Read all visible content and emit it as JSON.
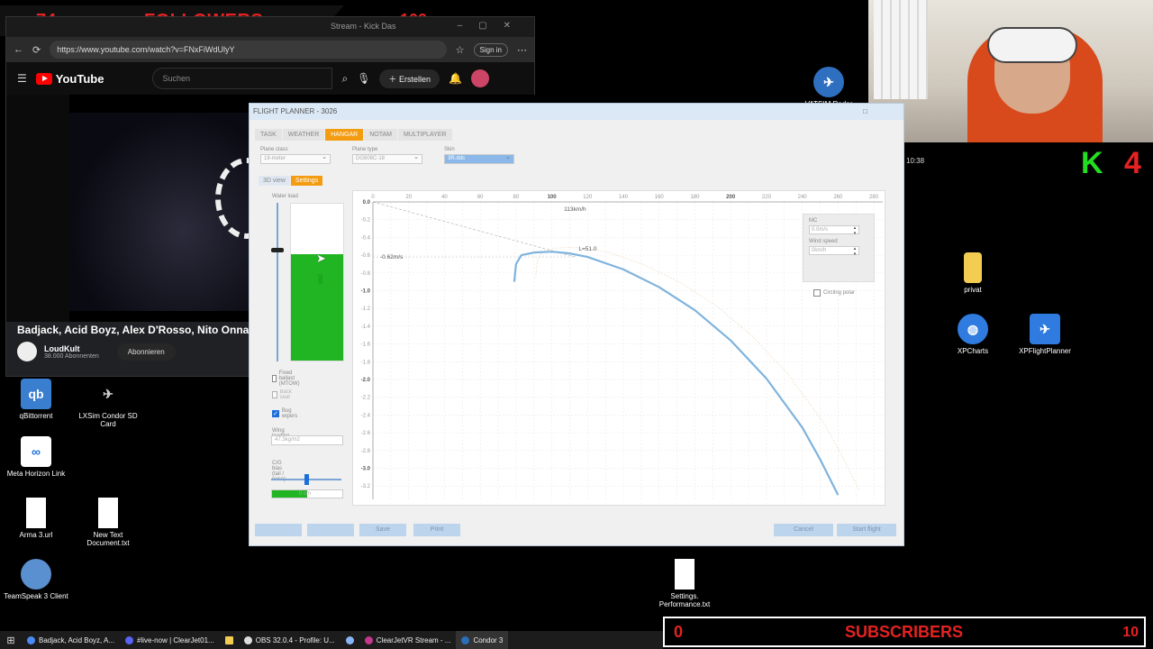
{
  "overlay": {
    "followers_count": "74",
    "followers_label": "FOLLOWERS",
    "followers_goal": "100",
    "subscribers_count": "0",
    "subscribers_label": "SUBSCRIBERS",
    "subscribers_goal": "10",
    "k_label": "K",
    "k_count": "4",
    "accent": "#e52222",
    "k_color": "#22dd22"
  },
  "browser": {
    "tab_title": "Stream - Kick Das",
    "url": "https://www.youtube.com/watch?v=FNxFiWdUlyY",
    "sign_in": "Sign in",
    "youtube": {
      "logo": "YouTube",
      "search_placeholder": "Suchen",
      "create": "Erstellen",
      "video_title": "Badjack, Acid Boyz, Alex D'Rosso, Nito Onna - Lo",
      "channel": "LoudKult",
      "subscribers": "38.000 Abonnenten",
      "subscribe": "Abonnieren"
    }
  },
  "desktop": {
    "icons": [
      {
        "label": "qBittorrent"
      },
      {
        "label": "LXSim Condor SD Card"
      },
      {
        "label": "Meta Horizon Link"
      },
      {
        "label": "Arma 3.url"
      },
      {
        "label": "New Text Document.txt"
      },
      {
        "label": "TeamSpeak 3 Client"
      },
      {
        "label": "privat"
      },
      {
        "label": "XPCharts"
      },
      {
        "label": "XPFlightPlanner"
      },
      {
        "label": "Settings. Performance.txt"
      },
      {
        "label": "VATSIM Radar"
      }
    ],
    "time": "10:38"
  },
  "flight_planner": {
    "title": "FLIGHT PLANNER - 3026",
    "tabs": [
      "TASK",
      "WEATHER",
      "HANGAR",
      "NOTAM",
      "MULTIPLAYER"
    ],
    "active_tab": "HANGAR",
    "plane_class_label": "Plane class",
    "plane_class_value": "18-meter",
    "plane_type_label": "Plane type",
    "plane_type_value": "DG808C-18",
    "skin_label": "Skin",
    "skin_value": "3R.dds",
    "subtabs": [
      "3D view",
      "Settings"
    ],
    "active_subtab": "Settings",
    "water_load_label": "Water load",
    "water_level": 0.68,
    "water_text": "150l",
    "fixed_ballast": "Fixed ballast (MTOW)",
    "back_seat": "Back seat",
    "bug_wipers": "Bug wipers",
    "wing_loading_label": "Wing loading",
    "wing_loading_value": "47.3kg/m2",
    "cg_label": "C/G bias (tail / nose)",
    "cg_value": "0 cm",
    "cg_position": 0.5,
    "mc_label": "MC",
    "mc_value": "0.0m/s",
    "wind_label": "Wind speed",
    "wind_value": "0km/h",
    "circling_polar": "Circling polar",
    "buttons": {
      "btn1": "",
      "btn2": "",
      "save": "Save",
      "print": "Print",
      "cancel": "Cancel",
      "start": "Start flight"
    }
  },
  "chart_data": {
    "type": "line",
    "x_ticks": [
      0,
      20,
      40,
      60,
      80,
      100,
      120,
      140,
      160,
      180,
      200,
      220,
      240,
      260,
      280
    ],
    "y_ticks": [
      "0.0",
      "-0.2",
      "-0.4",
      "-0.6",
      "-0.8",
      "-1.0",
      "-1.2",
      "-1.4",
      "-1.6",
      "-1.8",
      "-2.0",
      "-2.2",
      "-2.4",
      "-2.6",
      "-2.8",
      "-3.0",
      "-3.2"
    ],
    "xlim": [
      0,
      285
    ],
    "ylim": [
      -3.35,
      0
    ],
    "annotations": {
      "speed_label": "113km/h",
      "sink_label": "-0.62m/s",
      "glide_label": "L=51.0"
    },
    "series": [
      {
        "values": [
          [
            79,
            -0.9
          ],
          [
            80,
            -0.7
          ],
          [
            83,
            -0.6
          ],
          [
            90,
            -0.57
          ],
          [
            100,
            -0.56
          ],
          [
            110,
            -0.58
          ],
          [
            120,
            -0.62
          ],
          [
            140,
            -0.76
          ],
          [
            160,
            -0.96
          ],
          [
            180,
            -1.22
          ],
          [
            200,
            -1.56
          ],
          [
            220,
            -1.99
          ],
          [
            240,
            -2.54
          ],
          [
            250,
            -2.9
          ],
          [
            260,
            -3.3
          ]
        ],
        "color": "#7fb3dd"
      }
    ],
    "tangent": [
      [
        0,
        0
      ],
      [
        113,
        -0.62
      ]
    ]
  },
  "taskbar": {
    "items": [
      "Badjack, Acid Boyz, A...",
      "#live-now | ClearJet01...",
      "OBS 32.0.4 - Profile: U...",
      "ClearJetVR Stream - ...",
      "Condor 3"
    ]
  }
}
